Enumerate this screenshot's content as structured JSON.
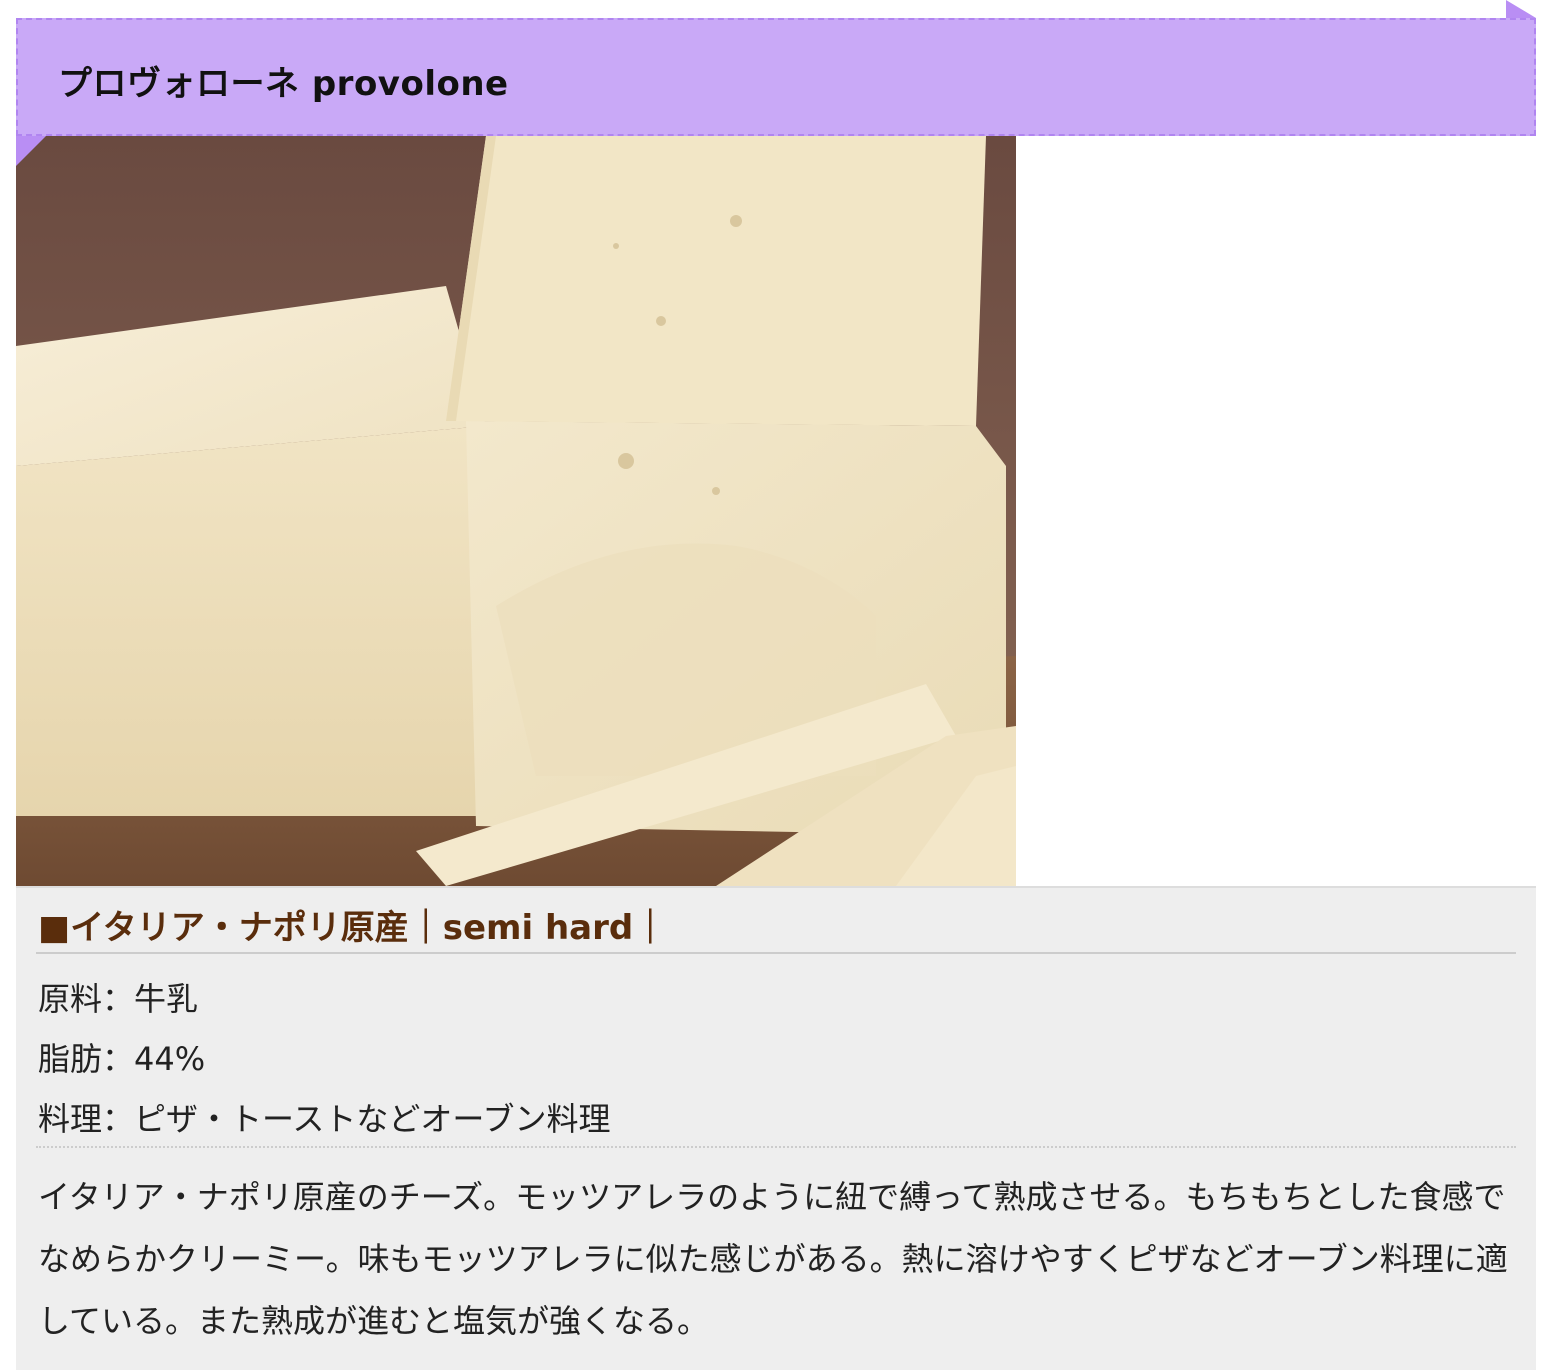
{
  "header": {
    "title": "プロヴォローネ provolone"
  },
  "photo": {
    "alt": "cheese-photo"
  },
  "info": {
    "origin_line": "■イタリア・ナポリ原産｜semi hard｜",
    "specs": [
      "原料：牛乳",
      "脂肪：44%",
      "料理：ピザ・トーストなどオーブン料理"
    ],
    "description": "イタリア・ナポリ原産のチーズ。モッツアレラのように紐で縛って熟成させる。もちもちとした食感でなめらかクリーミー。味もモッツアレラに似た感じがある。熱に溶けやすくピザなどオーブン料理に適している。また熟成が進むと塩気が強くなる。"
  },
  "colors": {
    "ribbon": "#c9a9f7",
    "ribbon_border": "#b085f0",
    "origin_text": "#5a2d0c",
    "panel_bg": "#eeeeee"
  }
}
